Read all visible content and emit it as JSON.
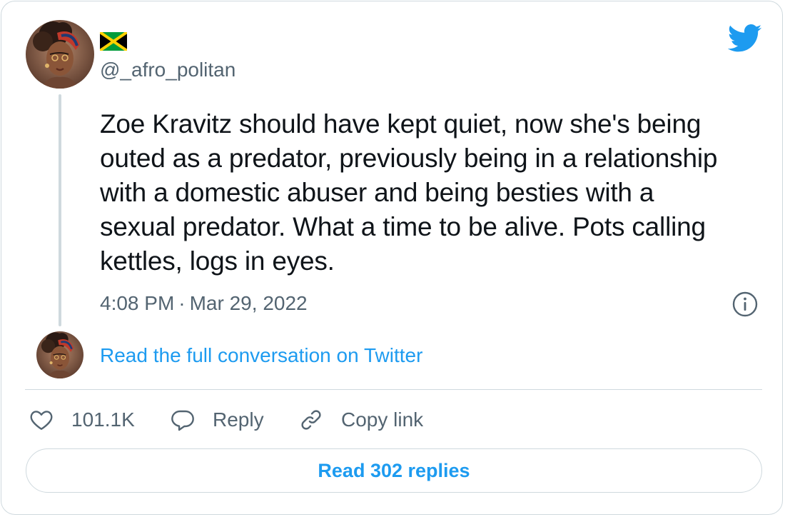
{
  "tweet": {
    "flag_emoji_name": "jamaica-flag",
    "handle": "@_afro_politan",
    "text": "Zoe Kravitz should have kept quiet, now she's being\nouted as a predator, previously being in a relationship\nwith a domestic abuser and being besties with a\nsexual predator. What a time to be alive. Pots calling\nkettles, logs in eyes.",
    "time": "4:08 PM",
    "separator": "·",
    "date": "Mar 29, 2022"
  },
  "conversation": {
    "link_label": "Read the full conversation on Twitter"
  },
  "actions": {
    "like_count": "101.1K",
    "reply_label": "Reply",
    "copy_label": "Copy link"
  },
  "footer": {
    "read_replies_label": "Read 302 replies"
  },
  "colors": {
    "twitter_blue": "#1d9bf0",
    "secondary_text": "#536471",
    "border": "#cfd9de",
    "primary_text": "#0f1419"
  },
  "icons": {
    "brand": "twitter-bird-icon",
    "info": "info-icon",
    "like": "heart-icon",
    "reply": "speech-bubble-icon",
    "copy": "link-icon"
  }
}
